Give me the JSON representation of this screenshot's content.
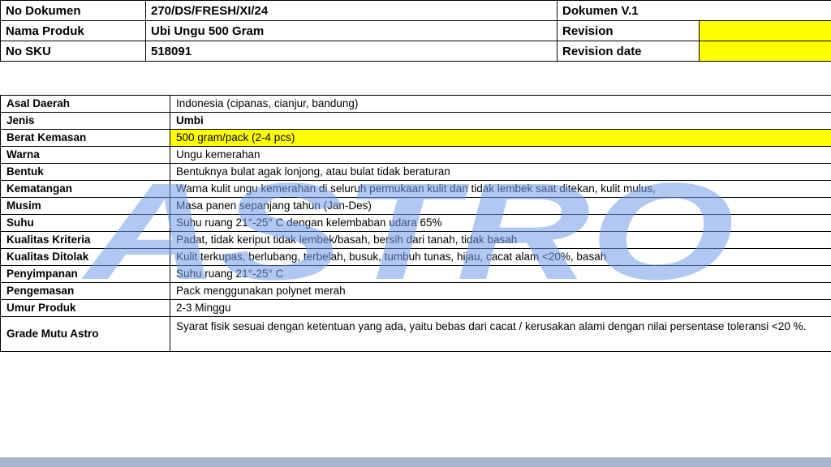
{
  "header": {
    "doc_no_label": "No Dokumen",
    "doc_no_value": "270/DS/FRESH/XI/24",
    "doc_version": "Dokumen V.1",
    "product_label": "Nama Produk",
    "product_value": "Ubi Ungu 500 Gram",
    "revision_label": "Revision",
    "revision_value": "",
    "sku_label": "No SKU",
    "sku_value": "518091",
    "revision_date_label": "Revision date",
    "revision_date_value": ""
  },
  "spec": {
    "rows": [
      {
        "label": "Asal Daerah",
        "value": "Indonesia (cipanas, cianjur, bandung)"
      },
      {
        "label": "Jenis",
        "value": "Umbi"
      },
      {
        "label": "Berat Kemasan",
        "value": "500 gram/pack (2-4 pcs)"
      },
      {
        "label": "Warna",
        "value": "Ungu kemerahan"
      },
      {
        "label": "Bentuk",
        "value": "Bentuknya bulat agak lonjong, atau bulat tidak beraturan"
      },
      {
        "label": "Kematangan",
        "value": "Warna kulit ungu kemerahan di seluruh permukaan kulit dan tidak lembek saat ditekan, kulit mulus,"
      },
      {
        "label": "Musim",
        "value": "Masa panen sepanjang tahun (Jan-Des)"
      },
      {
        "label": "Suhu",
        "value": "Suhu ruang 21°-25° C dengan kelembaban udara 65%"
      },
      {
        "label": "Kualitas Kriteria",
        "value": "Padat, tidak keriput tidak lembek/basah, bersih dari tanah, tidak basah"
      },
      {
        "label": "Kualitas Ditolak",
        "value": "Kulit terkupas, berlubang, terbelah, busuk, tumbuh tunas, hijau, cacat alam <20%, basah"
      },
      {
        "label": "Penyimpanan",
        "value": "Suhu ruang 21°-25° C"
      },
      {
        "label": "Pengemasan",
        "value": "Pack menggunakan polynet merah"
      },
      {
        "label": "Umur Produk",
        "value": "2-3 Minggu"
      },
      {
        "label": "Grade Mutu Astro",
        "value": "Syarat fisik sesuai dengan ketentuan yang ada, yaitu bebas dari cacat / kerusakan alami dengan nilai persentase toleransi <20 %."
      }
    ]
  },
  "watermark": {
    "text": "ASTRO",
    "color": "#6f9be8"
  },
  "colors": {
    "highlight": "#ffff00",
    "footer_bar": "#a9b4cf"
  }
}
